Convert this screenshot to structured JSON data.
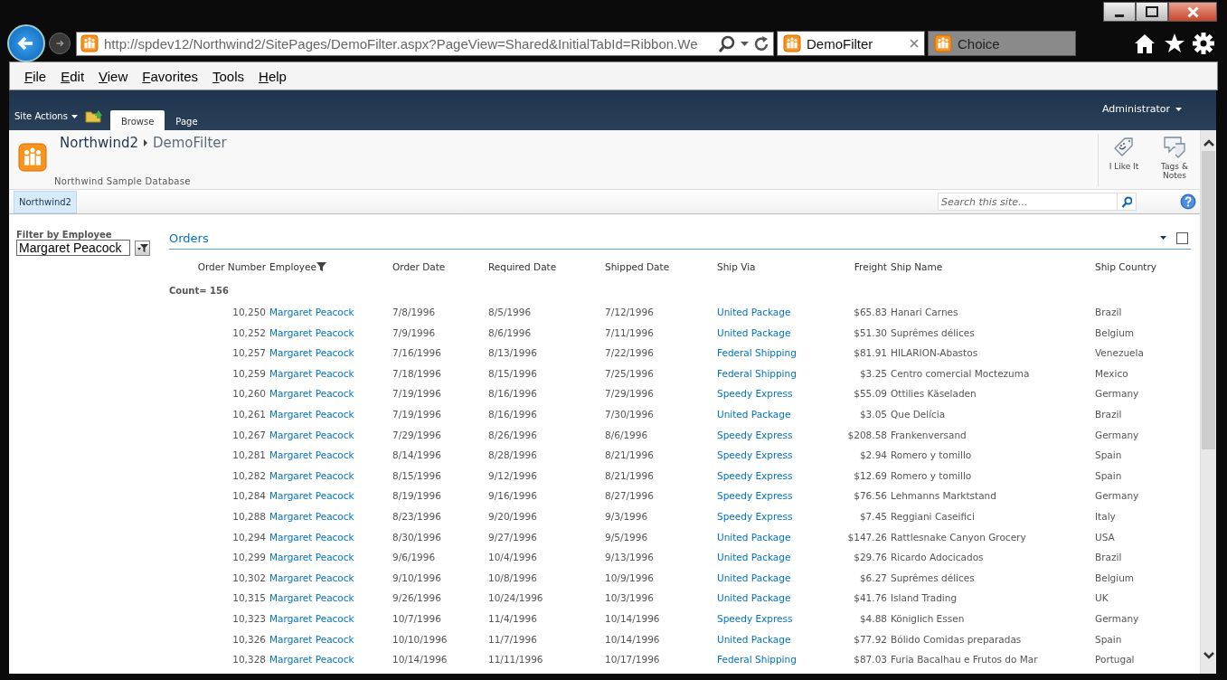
{
  "browser": {
    "address": "http://spdev12/Northwind2/SitePages/DemoFilter.aspx?PageView=Shared&InitialTabId=Ribbon.We",
    "tabs": [
      {
        "label": "DemoFilter",
        "selected": true
      },
      {
        "label": "Choice",
        "selected": false
      }
    ],
    "menu": [
      "File",
      "Edit",
      "View",
      "Favorites",
      "Tools",
      "Help"
    ]
  },
  "ribbon": {
    "site_actions": "Site Actions",
    "tabs": [
      {
        "label": "Browse",
        "selected": true
      },
      {
        "label": "Page",
        "selected": false
      }
    ],
    "user": "Administrator"
  },
  "header": {
    "site": "Northwind2",
    "page": "DemoFilter",
    "description": "Northwind Sample Database",
    "actions": [
      {
        "label": "I Like It",
        "kind": "like"
      },
      {
        "label": "Tags & Notes",
        "kind": "tags"
      }
    ]
  },
  "nav": {
    "items": [
      {
        "label": "Northwind2",
        "selected": true
      }
    ]
  },
  "search": {
    "placeholder": "Search this site..."
  },
  "filter": {
    "label": "Filter by Employee",
    "value": "Margaret Peacock"
  },
  "orders": {
    "title": "Orders",
    "checked": false,
    "count": "Count= 156",
    "columns": [
      {
        "label": "Order Number",
        "kind": "number",
        "filtered": false
      },
      {
        "label": "Employee",
        "kind": "link",
        "filtered": true
      },
      {
        "label": "Order Date",
        "kind": "text",
        "filtered": false
      },
      {
        "label": "Required Date",
        "kind": "text",
        "filtered": false
      },
      {
        "label": "Shipped Date",
        "kind": "text",
        "filtered": false
      },
      {
        "label": "Ship Via",
        "kind": "link",
        "filtered": false
      },
      {
        "label": "Freight",
        "kind": "number",
        "filtered": false
      },
      {
        "label": "Ship Name",
        "kind": "text",
        "filtered": false
      },
      {
        "label": "Ship Country",
        "kind": "text",
        "filtered": false
      }
    ],
    "rows": [
      [
        "10,250",
        "Margaret Peacock",
        "7/8/1996",
        "8/5/1996",
        "7/12/1996",
        "United Package",
        "$65.83",
        "Hanari Carnes",
        "Brazil"
      ],
      [
        "10,252",
        "Margaret Peacock",
        "7/9/1996",
        "8/6/1996",
        "7/11/1996",
        "United Package",
        "$51.30",
        "Suprêmes délices",
        "Belgium"
      ],
      [
        "10,257",
        "Margaret Peacock",
        "7/16/1996",
        "8/13/1996",
        "7/22/1996",
        "Federal Shipping",
        "$81.91",
        "HILARION-Abastos",
        "Venezuela"
      ],
      [
        "10,259",
        "Margaret Peacock",
        "7/18/1996",
        "8/15/1996",
        "7/25/1996",
        "Federal Shipping",
        "$3.25",
        "Centro comercial Moctezuma",
        "Mexico"
      ],
      [
        "10,260",
        "Margaret Peacock",
        "7/19/1996",
        "8/16/1996",
        "7/29/1996",
        "Speedy Express",
        "$55.09",
        "Ottilies Käseladen",
        "Germany"
      ],
      [
        "10,261",
        "Margaret Peacock",
        "7/19/1996",
        "8/16/1996",
        "7/30/1996",
        "United Package",
        "$3.05",
        "Que Delícia",
        "Brazil"
      ],
      [
        "10,267",
        "Margaret Peacock",
        "7/29/1996",
        "8/26/1996",
        "8/6/1996",
        "Speedy Express",
        "$208.58",
        "Frankenversand",
        "Germany"
      ],
      [
        "10,281",
        "Margaret Peacock",
        "8/14/1996",
        "8/28/1996",
        "8/21/1996",
        "Speedy Express",
        "$2.94",
        "Romero y tomillo",
        "Spain"
      ],
      [
        "10,282",
        "Margaret Peacock",
        "8/15/1996",
        "9/12/1996",
        "8/21/1996",
        "Speedy Express",
        "$12.69",
        "Romero y tomillo",
        "Spain"
      ],
      [
        "10,284",
        "Margaret Peacock",
        "8/19/1996",
        "9/16/1996",
        "8/27/1996",
        "Speedy Express",
        "$76.56",
        "Lehmanns Marktstand",
        "Germany"
      ],
      [
        "10,288",
        "Margaret Peacock",
        "8/23/1996",
        "9/20/1996",
        "9/3/1996",
        "Speedy Express",
        "$7.45",
        "Reggiani Caseifici",
        "Italy"
      ],
      [
        "10,294",
        "Margaret Peacock",
        "8/30/1996",
        "9/27/1996",
        "9/5/1996",
        "United Package",
        "$147.26",
        "Rattlesnake Canyon Grocery",
        "USA"
      ],
      [
        "10,299",
        "Margaret Peacock",
        "9/6/1996",
        "10/4/1996",
        "9/13/1996",
        "United Package",
        "$29.76",
        "Ricardo Adocicados",
        "Brazil"
      ],
      [
        "10,302",
        "Margaret Peacock",
        "9/10/1996",
        "10/8/1996",
        "10/9/1996",
        "United Package",
        "$6.27",
        "Suprêmes délices",
        "Belgium"
      ],
      [
        "10,315",
        "Margaret Peacock",
        "9/26/1996",
        "10/24/1996",
        "10/3/1996",
        "United Package",
        "$41.76",
        "Island Trading",
        "UK"
      ],
      [
        "10,323",
        "Margaret Peacock",
        "10/7/1996",
        "11/4/1996",
        "10/14/1996",
        "Speedy Express",
        "$4.88",
        "Königlich Essen",
        "Germany"
      ],
      [
        "10,326",
        "Margaret Peacock",
        "10/10/1996",
        "11/7/1996",
        "10/14/1996",
        "United Package",
        "$77.92",
        "Bólido Comidas preparadas",
        "Spain"
      ],
      [
        "10,328",
        "Margaret Peacock",
        "10/14/1996",
        "11/11/1996",
        "10/17/1996",
        "Federal Shipping",
        "$87.03",
        "Furia Bacalhau e Frutos do Mar",
        "Portugal"
      ]
    ]
  }
}
